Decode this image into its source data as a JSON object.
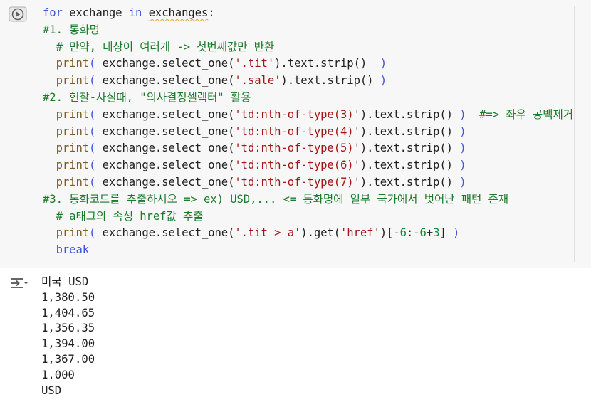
{
  "code_lines": [
    {
      "indent": 0,
      "tokens": [
        {
          "t": "for",
          "c": "kw"
        },
        {
          "t": " exchange ",
          "c": ""
        },
        {
          "t": "in",
          "c": "kw"
        },
        {
          "t": " ",
          "c": ""
        },
        {
          "t": "exchanges",
          "c": "squig"
        },
        {
          "t": ":",
          "c": ""
        }
      ]
    },
    {
      "indent": 0,
      "tokens": [
        {
          "t": "#1. 통화명",
          "c": "cm"
        }
      ]
    },
    {
      "indent": 1,
      "tokens": [
        {
          "t": "# 만약, 대상이 여러개 -> 첫번째값만 반환",
          "c": "cm"
        }
      ]
    },
    {
      "indent": 1,
      "tokens": [
        {
          "t": "print",
          "c": "fn"
        },
        {
          "t": "(",
          "c": "pn"
        },
        {
          "t": " exchange.select_one(",
          "c": ""
        },
        {
          "t": "'.tit'",
          "c": "str"
        },
        {
          "t": ").text.strip()  ",
          "c": ""
        },
        {
          "t": ")",
          "c": "pn"
        }
      ]
    },
    {
      "indent": 1,
      "tokens": [
        {
          "t": "print",
          "c": "fn"
        },
        {
          "t": "(",
          "c": "pn"
        },
        {
          "t": " exchange.select_one(",
          "c": ""
        },
        {
          "t": "'.sale'",
          "c": "str"
        },
        {
          "t": ").text.strip() ",
          "c": ""
        },
        {
          "t": ")",
          "c": "pn"
        }
      ]
    },
    {
      "indent": 0,
      "tokens": [
        {
          "t": "#2. 현찰-사실때, \"의사결정셀렉터\" 활용",
          "c": "cm"
        }
      ]
    },
    {
      "indent": 1,
      "tokens": [
        {
          "t": "print",
          "c": "fn"
        },
        {
          "t": "(",
          "c": "pn"
        },
        {
          "t": " exchange.select_one(",
          "c": ""
        },
        {
          "t": "'td:nth-of-type(3)'",
          "c": "str"
        },
        {
          "t": ").text.strip() ",
          "c": ""
        },
        {
          "t": ")",
          "c": "pn"
        },
        {
          "t": "  ",
          "c": ""
        },
        {
          "t": "#=> 좌우 공백제거",
          "c": "cm"
        }
      ]
    },
    {
      "indent": 1,
      "tokens": [
        {
          "t": "print",
          "c": "fn"
        },
        {
          "t": "(",
          "c": "pn"
        },
        {
          "t": " exchange.select_one(",
          "c": ""
        },
        {
          "t": "'td:nth-of-type(4)'",
          "c": "str"
        },
        {
          "t": ").text.strip() ",
          "c": ""
        },
        {
          "t": ")",
          "c": "pn"
        }
      ]
    },
    {
      "indent": 1,
      "tokens": [
        {
          "t": "print",
          "c": "fn"
        },
        {
          "t": "(",
          "c": "pn"
        },
        {
          "t": " exchange.select_one(",
          "c": ""
        },
        {
          "t": "'td:nth-of-type(5)'",
          "c": "str"
        },
        {
          "t": ").text.strip() ",
          "c": ""
        },
        {
          "t": ")",
          "c": "pn"
        }
      ]
    },
    {
      "indent": 1,
      "tokens": [
        {
          "t": "print",
          "c": "fn"
        },
        {
          "t": "(",
          "c": "pn"
        },
        {
          "t": " exchange.select_one(",
          "c": ""
        },
        {
          "t": "'td:nth-of-type(6)'",
          "c": "str"
        },
        {
          "t": ").text.strip() ",
          "c": ""
        },
        {
          "t": ")",
          "c": "pn"
        }
      ]
    },
    {
      "indent": 1,
      "tokens": [
        {
          "t": "print",
          "c": "fn"
        },
        {
          "t": "(",
          "c": "pn"
        },
        {
          "t": " exchange.select_one(",
          "c": ""
        },
        {
          "t": "'td:nth-of-type(7)'",
          "c": "str"
        },
        {
          "t": ").text.strip() ",
          "c": ""
        },
        {
          "t": ")",
          "c": "pn"
        }
      ]
    },
    {
      "indent": 0,
      "tokens": [
        {
          "t": "#3. 통화코드를 추출하시오 => ex) USD,... <= 통화명에 일부 국가에서 벗어난 패턴 존재",
          "c": "cm"
        }
      ]
    },
    {
      "indent": 1,
      "tokens": [
        {
          "t": "# a태그의 속성 href값 추출",
          "c": "cm"
        }
      ]
    },
    {
      "indent": 1,
      "tokens": [
        {
          "t": "print",
          "c": "fn"
        },
        {
          "t": "(",
          "c": "pn"
        },
        {
          "t": " exchange.select_one(",
          "c": ""
        },
        {
          "t": "'.tit > a'",
          "c": "str"
        },
        {
          "t": ").get(",
          "c": ""
        },
        {
          "t": "'href'",
          "c": "str"
        },
        {
          "t": ")[",
          "c": ""
        },
        {
          "t": "-6",
          "c": "num"
        },
        {
          "t": ":",
          "c": ""
        },
        {
          "t": "-6",
          "c": "num"
        },
        {
          "t": "+",
          "c": ""
        },
        {
          "t": "3",
          "c": "num"
        },
        {
          "t": "] ",
          "c": ""
        },
        {
          "t": ")",
          "c": "pn"
        }
      ]
    },
    {
      "indent": 1,
      "tokens": [
        {
          "t": "break",
          "c": "kw"
        }
      ]
    }
  ],
  "output_lines": [
    "미국 USD",
    "1,380.50",
    "1,404.65",
    "1,356.35",
    "1,394.00",
    "1,367.00",
    "1.000",
    "USD"
  ],
  "icons": {
    "run": "play-circle-icon",
    "output_toggle": "output-collapse-icon"
  },
  "colors": {
    "cell_bg": "#f7f7f7",
    "keyword": "#3f56d6",
    "comment": "#1a7c2a",
    "string": "#a31515",
    "number": "#0a8a3a",
    "function": "#795e26"
  }
}
